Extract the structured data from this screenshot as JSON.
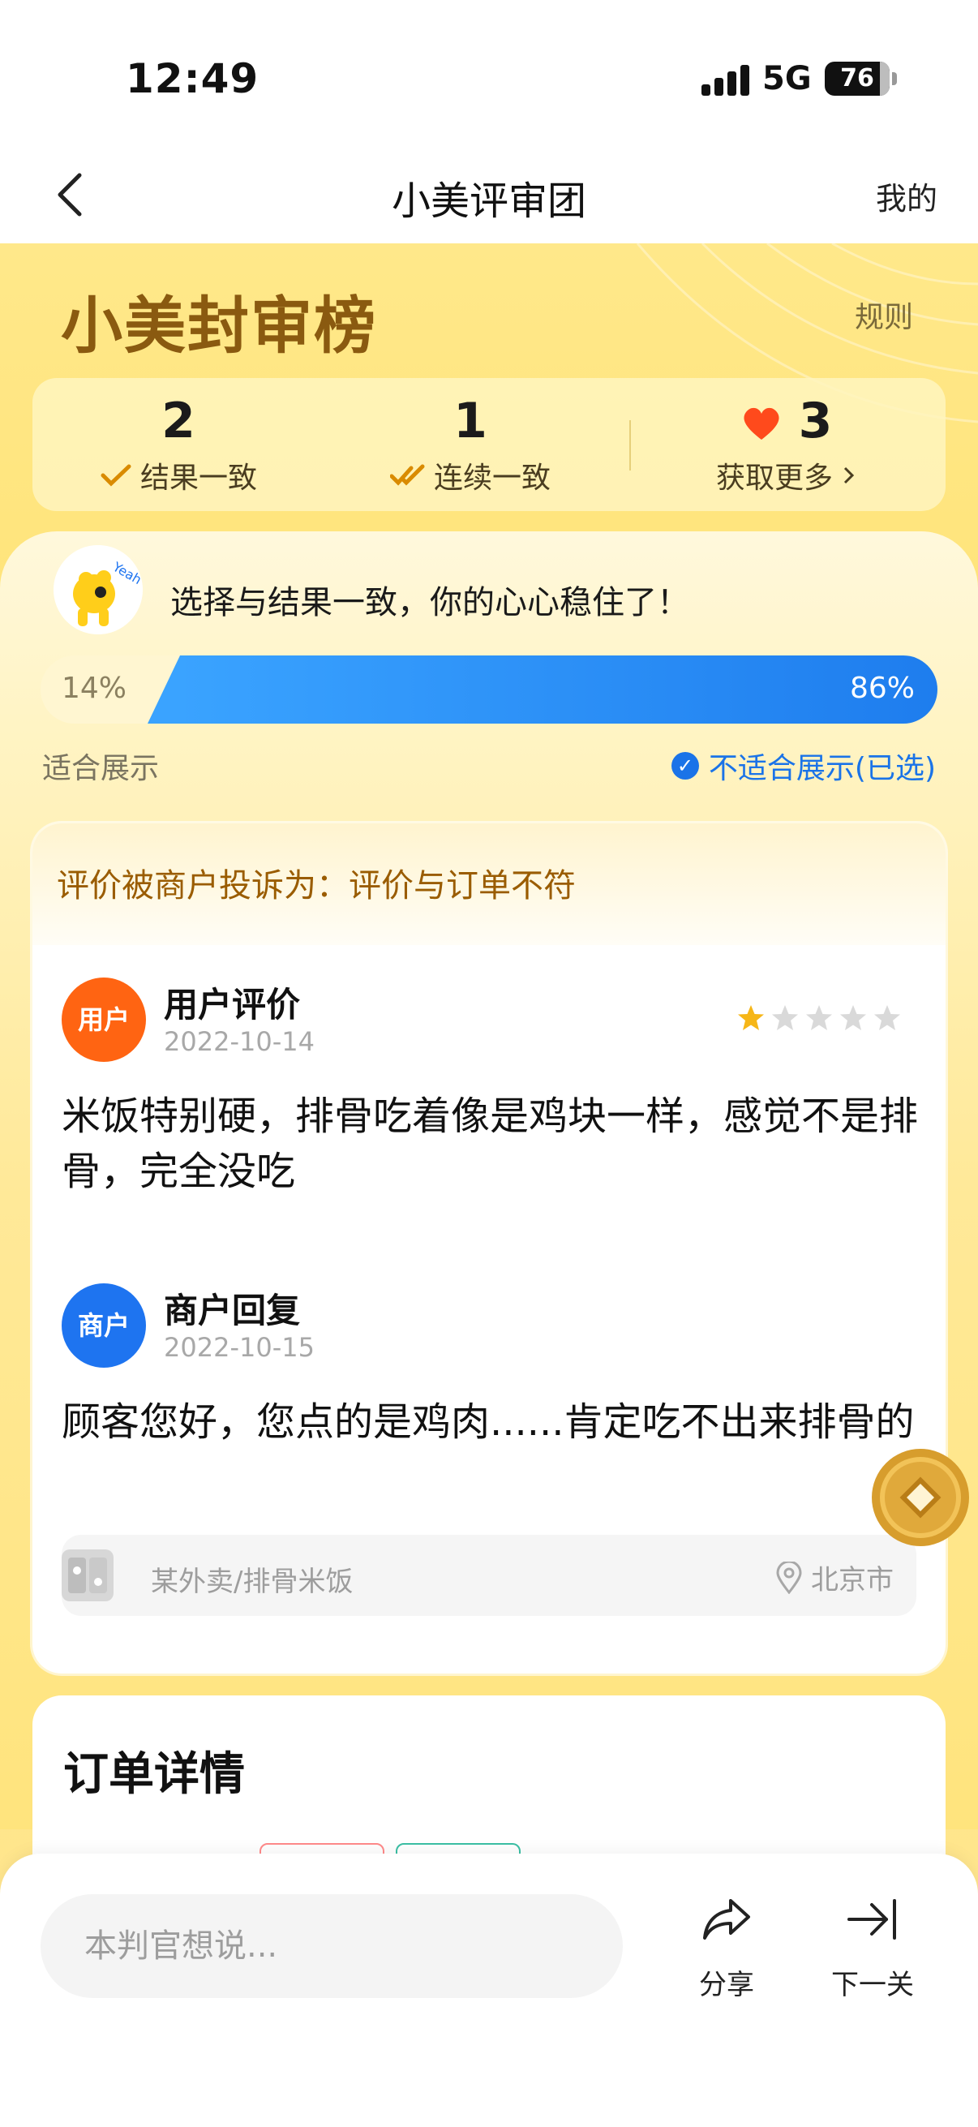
{
  "status_bar": {
    "time": "12:49",
    "network": "5G",
    "battery": "76"
  },
  "nav": {
    "title": "小美评审团",
    "right_link": "我的"
  },
  "header": {
    "brand_title": "小美封审榜",
    "rules_link": "规则"
  },
  "stats": {
    "items": [
      {
        "value": "2",
        "label": "结果一致"
      },
      {
        "value": "1",
        "label": "连续一致"
      },
      {
        "value": "3",
        "label": "获取更多"
      }
    ]
  },
  "vote": {
    "tip": "选择与结果一致，你的心心稳住了！",
    "left_percent": "14%",
    "right_percent": "86%",
    "left_fraction": 0.14,
    "right_fraction": 0.86,
    "left_option": "适合展示",
    "right_option": "不适合展示(已选)"
  },
  "case": {
    "complaint": "评价被商户投诉为：评价与订单不符",
    "user_review": {
      "avatar_label": "用户",
      "title": "用户评价",
      "date": "2022-10-14",
      "rating": 1,
      "rating_max": 5,
      "text": "米饭特别硬，排骨吃着像是鸡块一样，感觉不是排骨，完全没吃"
    },
    "merchant_reply": {
      "avatar_label": "商户",
      "title": "商户回复",
      "date": "2022-10-15",
      "text": "顾客您好，您点的是鸡肉......肯定吃不出来排骨的"
    },
    "shop": {
      "name": "某外卖/排骨米饭",
      "location": "北京市"
    }
  },
  "order": {
    "title": "订单详情"
  },
  "bottom": {
    "input_placeholder": "本判官想说...",
    "share_label": "分享",
    "next_label": "下一关"
  },
  "colors": {
    "accent_blue": "#1e7dee",
    "brand_gold": "#8a5a10",
    "user_orange": "#ff6412",
    "merchant_blue": "#1e74f0",
    "star_yellow": "#f6b617",
    "heart_red": "#ff4a1c"
  }
}
